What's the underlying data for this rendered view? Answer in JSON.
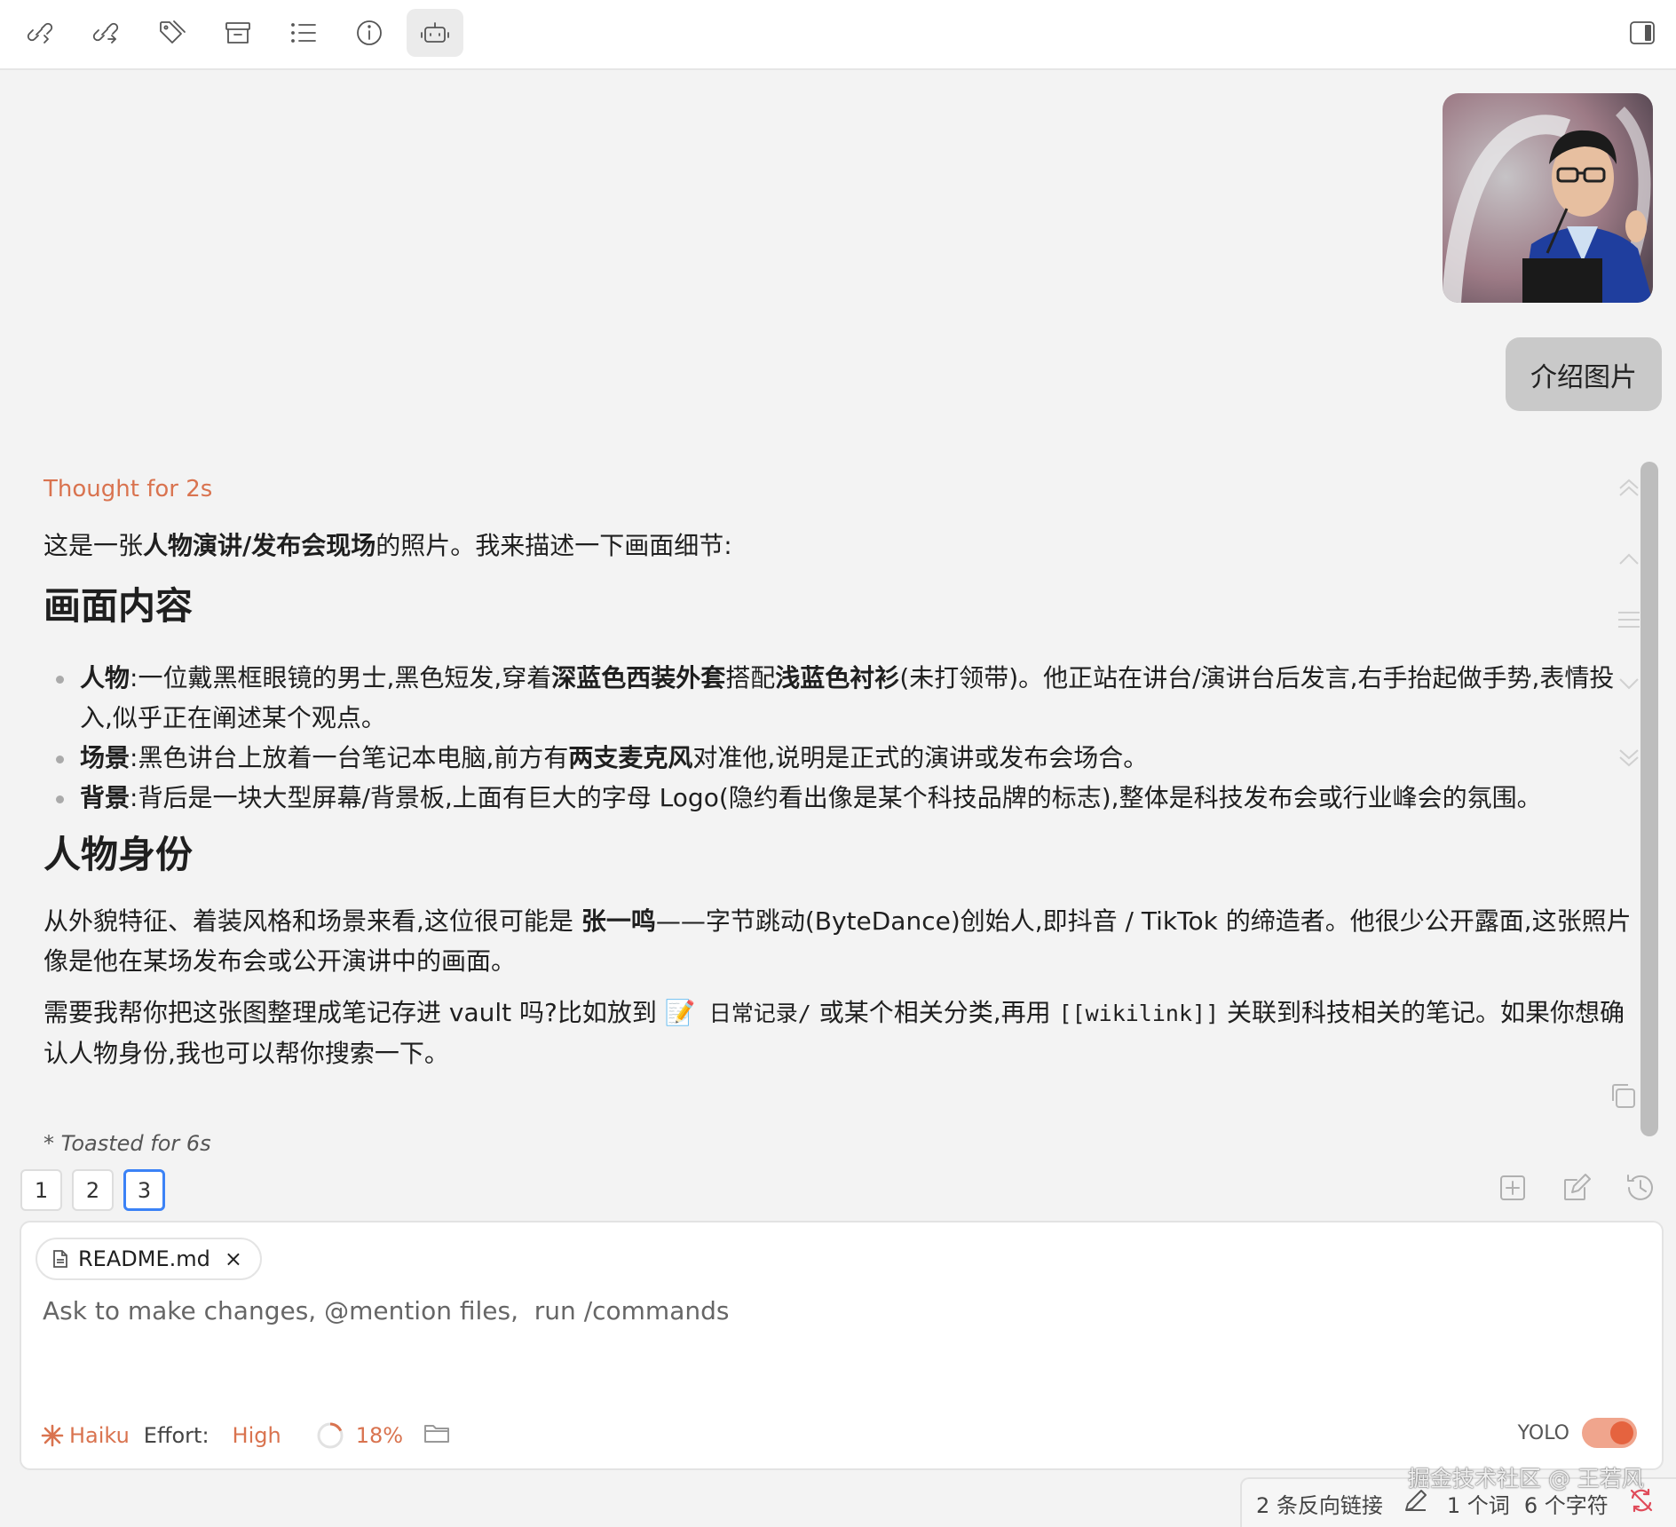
{
  "toolbar": {
    "icons": [
      "link-in-icon",
      "link-out-icon",
      "tags-icon",
      "archive-icon",
      "outline-icon",
      "info-icon",
      "bot-icon",
      "sidebar-toggle-icon"
    ]
  },
  "chat": {
    "user_message": "介绍图片",
    "thought_label": "Thought for 2s",
    "intro": {
      "pre": "这是一张",
      "bold": "人物演讲/发布会现场",
      "post": "的照片。我来描述一下画面细节:"
    },
    "section1_title": "画面内容",
    "bullets": [
      {
        "label": "人物",
        "parts": [
          ":一位戴黑框眼镜的男士,黑色短发,穿着",
          "深蓝色西装外套",
          "搭配",
          "浅蓝色衬衫",
          "(未打领带)。他正站在讲台/演讲台后发言,右手抬起做手势,表情投入,似乎正在阐述某个观点。"
        ]
      },
      {
        "label": "场景",
        "parts": [
          ":黑色讲台上放着一台笔记本电脑,前方有",
          "两支麦克风",
          "对准他,说明是正式的演讲或发布会场合。"
        ]
      },
      {
        "label": "背景",
        "parts": [
          ":背后是一块大型屏幕/背景板,上面有巨大的字母 Logo(隐约看出像是某个科技品牌的标志),整体是科技发布会或行业峰会的氛围。"
        ]
      }
    ],
    "section2_title": "人物身份",
    "identity": {
      "pre": "从外貌特征、着装风格和场景来看,这位很可能是 ",
      "bold": "张一鸣",
      "post": "——字节跳动(ByteDance)创始人,即抖音 / TikTok 的缔造者。他很少公开露面,这张照片像是他在某场发布会或公开演讲中的画面。"
    },
    "followup": {
      "pre": "需要我帮你把这张图整理成笔记存进 vault 吗?比如放到 ",
      "emoji": "📝",
      "folder": " 日常记录/",
      "mid": " 或某个相关分类,再用 ",
      "wikilink": "[[wikilink]]",
      "post": " 关联到科技相关的笔记。如果你想确认人物身份,我也可以帮你搜索一下。"
    },
    "toasted": "* Toasted for 6s"
  },
  "tabs": [
    "1",
    "2",
    "3"
  ],
  "active_tab": "3",
  "input": {
    "chip_label": "README.md",
    "chip_close": "×",
    "placeholder": "Ask to make changes, @mention files,  run /commands",
    "value": ""
  },
  "footer": {
    "model": "Haiku",
    "effort_label": "Effort:",
    "effort_value": "High",
    "context_percent": "18%",
    "context_fraction": 0.18,
    "yolo_label": "YOLO",
    "yolo_on": true
  },
  "status": {
    "backlinks": "2 条反向链接",
    "words": "1 个词",
    "chars": "6 个字符"
  },
  "watermark": "掘金技术社区 @ 王若风",
  "colors": {
    "accent": "#d9734f",
    "tab_active": "#3b82f6",
    "toggle_on": "#e5633f"
  }
}
